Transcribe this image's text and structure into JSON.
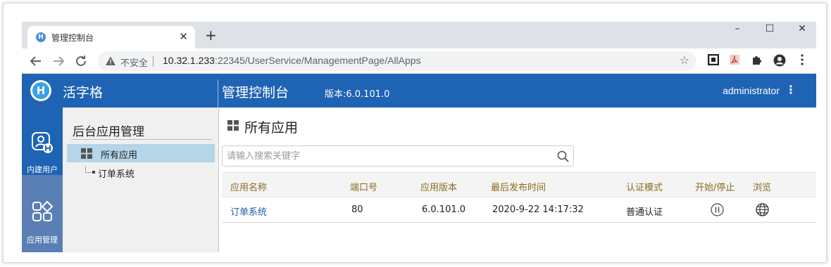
{
  "browser": {
    "tab_title": "管理控制台",
    "tab_favicon_letter": "H",
    "tab_close": "✕",
    "new_tab": "+",
    "window_controls": [
      "–",
      "☐",
      "✕"
    ],
    "nav_icons": [
      "back-arrow-icon",
      "forward-arrow-icon",
      "reload-icon"
    ],
    "security_label": "不安全",
    "url_host": "10.32.1.233",
    "url_path": ":22345/UserService/ManagementPage/AllApps",
    "extension_icons": [
      "qr-code-icon",
      "pdf-icon",
      "puzzle-icon",
      "account-icon",
      "menu-dots-icon"
    ]
  },
  "header": {
    "logo_letter": "H",
    "brand": "活字格",
    "title": "管理控制台",
    "version": "版本:6.0.101.0",
    "user": "administrator",
    "menu_icon": "⋮"
  },
  "rail": {
    "items": [
      {
        "label": "内建用户",
        "icon": "user-icon",
        "active": true
      },
      {
        "label": "应用管理",
        "icon": "apps-icon",
        "active": false
      }
    ]
  },
  "tree": {
    "heading": "后台应用管理",
    "selected": "所有应用",
    "children": [
      "订单系统"
    ]
  },
  "main": {
    "title": "所有应用",
    "search": {
      "placeholder": "请输入搜索关键字",
      "value": ""
    },
    "columns": [
      "应用名称",
      "端口号",
      "应用版本",
      "最后发布时间",
      "认证模式",
      "开始/停止",
      "浏览"
    ],
    "rows": [
      {
        "name": "订单系统",
        "port": "80",
        "version": "6.0.101.0",
        "published": "2020-9-22 14:17:32",
        "auth": "普通认证",
        "toggle_icon": "pause-icon",
        "browse_icon": "globe-icon"
      }
    ]
  },
  "colors": {
    "header_bg": "#1f63b4",
    "rail_bg": "#5a7fb5",
    "tree_selected": "#b5d5e8",
    "column_header_text": "#8a6a1e",
    "link": "#1f5fa8"
  }
}
